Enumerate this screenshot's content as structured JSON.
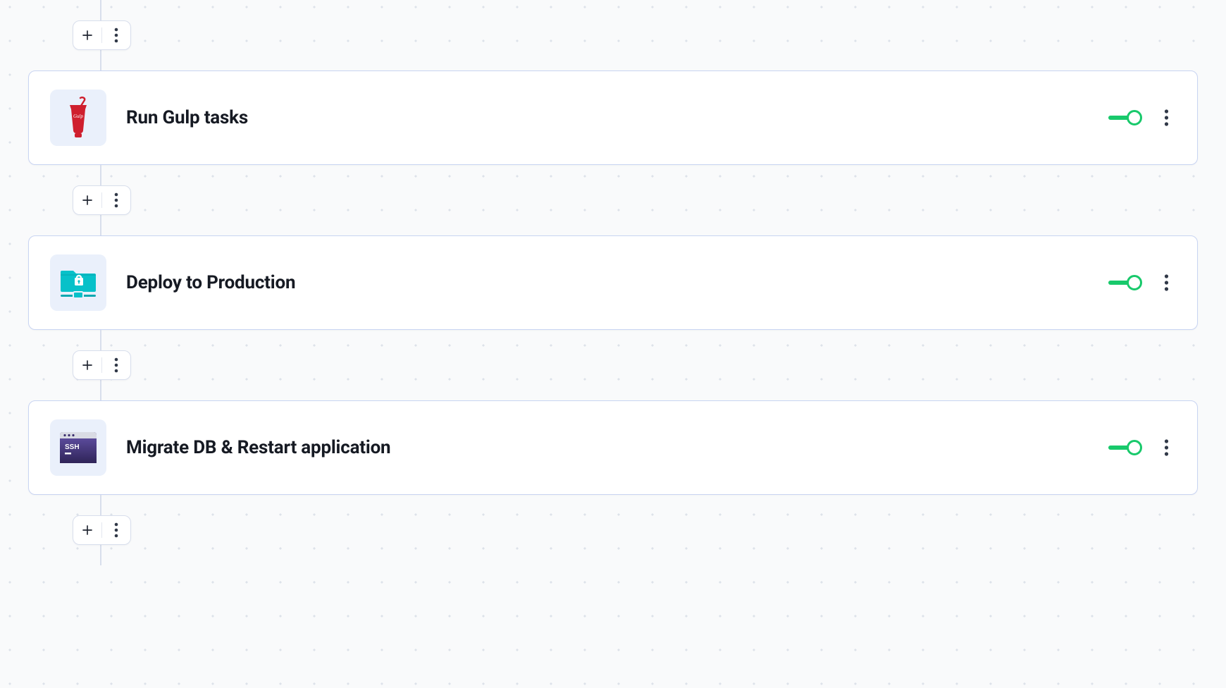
{
  "pipeline": {
    "steps": [
      {
        "title": "Run Gulp tasks",
        "icon": "gulp-icon",
        "enabled": true
      },
      {
        "title": "Deploy to Production",
        "icon": "deploy-icon",
        "enabled": true
      },
      {
        "title": "Migrate DB & Restart application",
        "icon": "ssh-icon",
        "enabled": true
      }
    ]
  },
  "icons": {
    "ssh_label": "SSH"
  },
  "colors": {
    "card_border": "#c8d4f2",
    "toggle_on": "#18c96b",
    "icon_bg": "#eaf0fb",
    "gulp_red": "#cf1f2e",
    "deploy_teal": "#07c1c9",
    "ssh_purple": "#3a2e6e"
  }
}
